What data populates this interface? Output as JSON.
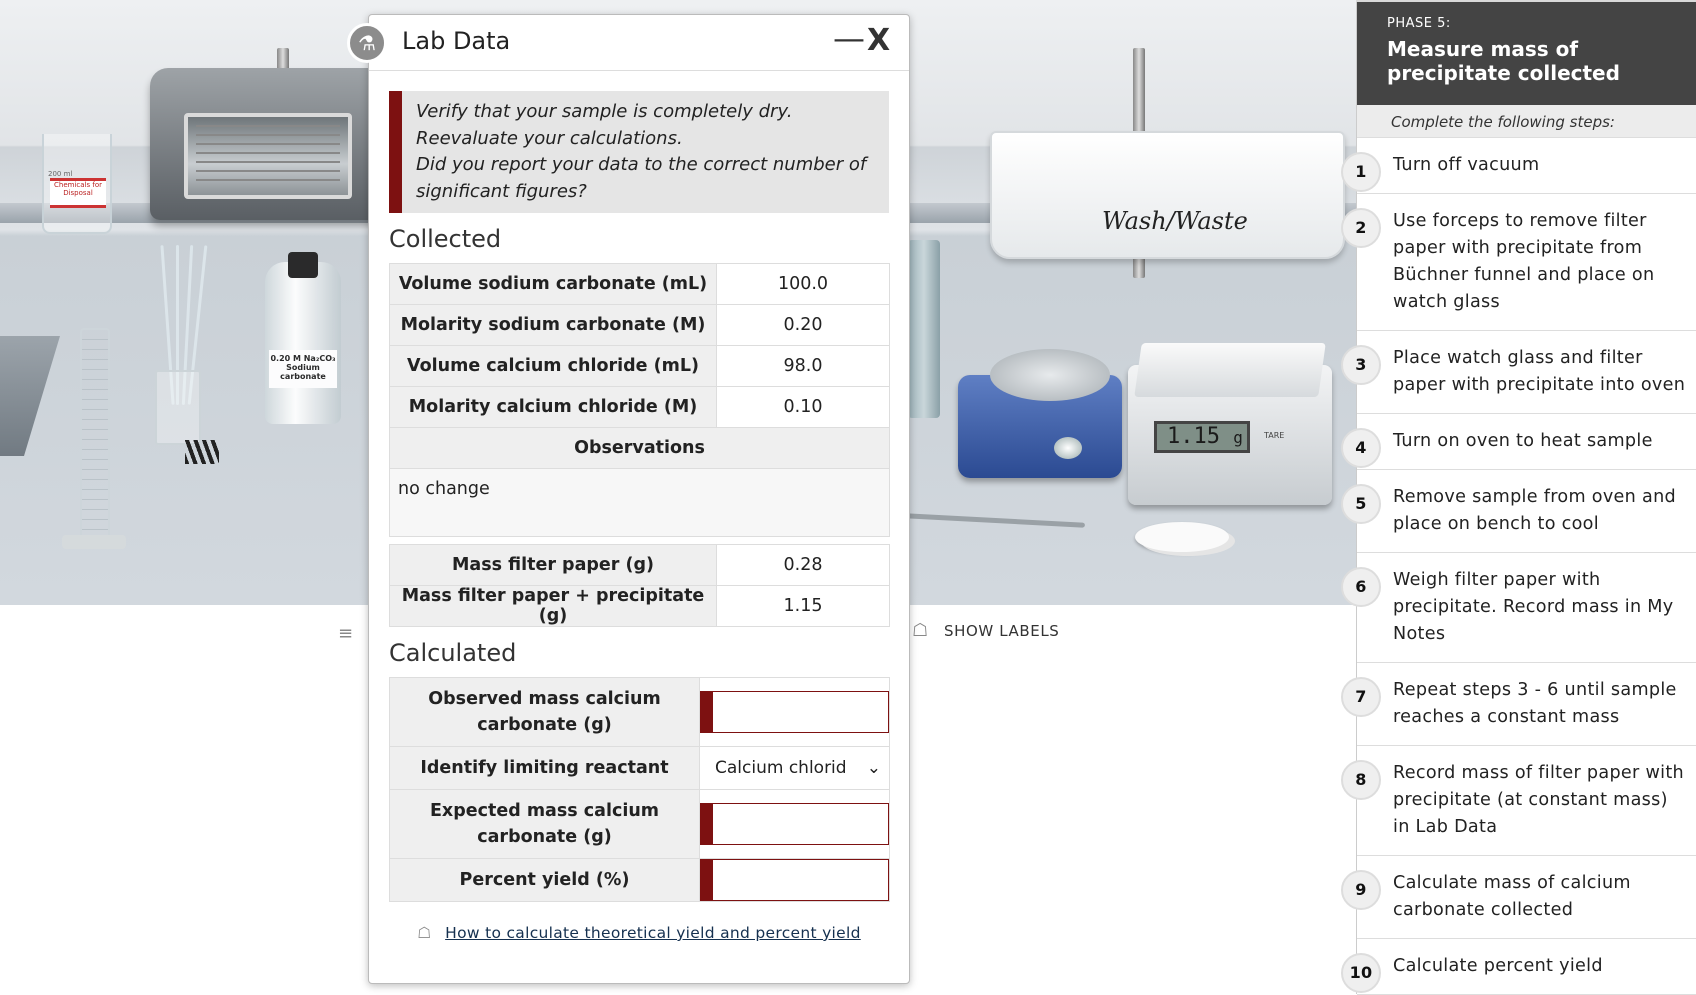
{
  "lab_scene": {
    "beaker_label": "Chemicals for Disposal",
    "beaker_volume": "200 ml",
    "bottle_label": "0.20 M Na₂CO₃ Sodium carbonate",
    "tub_label": "Wash/Waste",
    "balance_display": "1.15",
    "balance_unit": "g",
    "tare_label": "TARE",
    "show_labels": "SHOW LABELS"
  },
  "dialog": {
    "title": "Lab Data",
    "minimize": "—",
    "close": "X",
    "warning_lines": [
      "Verify that your sample is completely dry.",
      "Reevaluate your calculations.",
      "Did you report your data to the correct number of significant figures?"
    ],
    "collected_heading": "Collected",
    "collected_rows": [
      {
        "label": "Volume sodium carbonate (mL)",
        "value": "100.0"
      },
      {
        "label": "Molarity sodium carbonate (M)",
        "value": "0.20"
      },
      {
        "label": "Volume calcium chloride (mL)",
        "value": "98.0"
      },
      {
        "label": "Molarity calcium chloride (M)",
        "value": "0.10"
      }
    ],
    "observations_label": "Observations",
    "observations_value": "no change",
    "mass_rows": [
      {
        "label": "Mass filter paper (g)",
        "value": "0.28"
      },
      {
        "label": "Mass filter paper + precipitate (g)",
        "value": "1.15"
      }
    ],
    "calculated_heading": "Calculated",
    "calc_rows": [
      {
        "label": "Observed mass calcium carbonate (g)",
        "value": ""
      },
      {
        "label": "Identify limiting reactant",
        "value": "Calcium chlorid"
      },
      {
        "label": "Expected mass calcium carbonate (g)",
        "value": ""
      },
      {
        "label": "Percent yield (%)",
        "value": ""
      }
    ],
    "help_link": "How to calculate theoretical yield and percent yield"
  },
  "panel": {
    "phase_label": "PHASE 5:",
    "phase_title": "Measure mass of precipitate collected",
    "instructions": "Complete the following steps:",
    "steps": [
      {
        "num": "1",
        "text": "Turn off vacuum"
      },
      {
        "num": "2",
        "text": "Use forceps to remove filter paper with precipitate from Büchner funnel and place on watch glass"
      },
      {
        "num": "3",
        "text": "Place watch glass and filter paper with precipitate into oven"
      },
      {
        "num": "4",
        "text": "Turn on oven to heat sample"
      },
      {
        "num": "5",
        "text": "Remove sample from oven and place on bench to cool"
      },
      {
        "num": "6",
        "text": "Weigh filter paper with precipitate. Record mass in My Notes"
      },
      {
        "num": "7",
        "text": "Repeat steps 3 - 6 until sample reaches a constant mass"
      },
      {
        "num": "8",
        "text": "Record mass of filter paper with precipitate (at constant mass) in Lab Data"
      },
      {
        "num": "9",
        "text": "Calculate mass of calcium carbonate collected"
      },
      {
        "num": "10",
        "text": "Calculate percent yield"
      }
    ]
  },
  "colors": {
    "accent_red": "#7d1111",
    "phase_bg": "#444444"
  }
}
